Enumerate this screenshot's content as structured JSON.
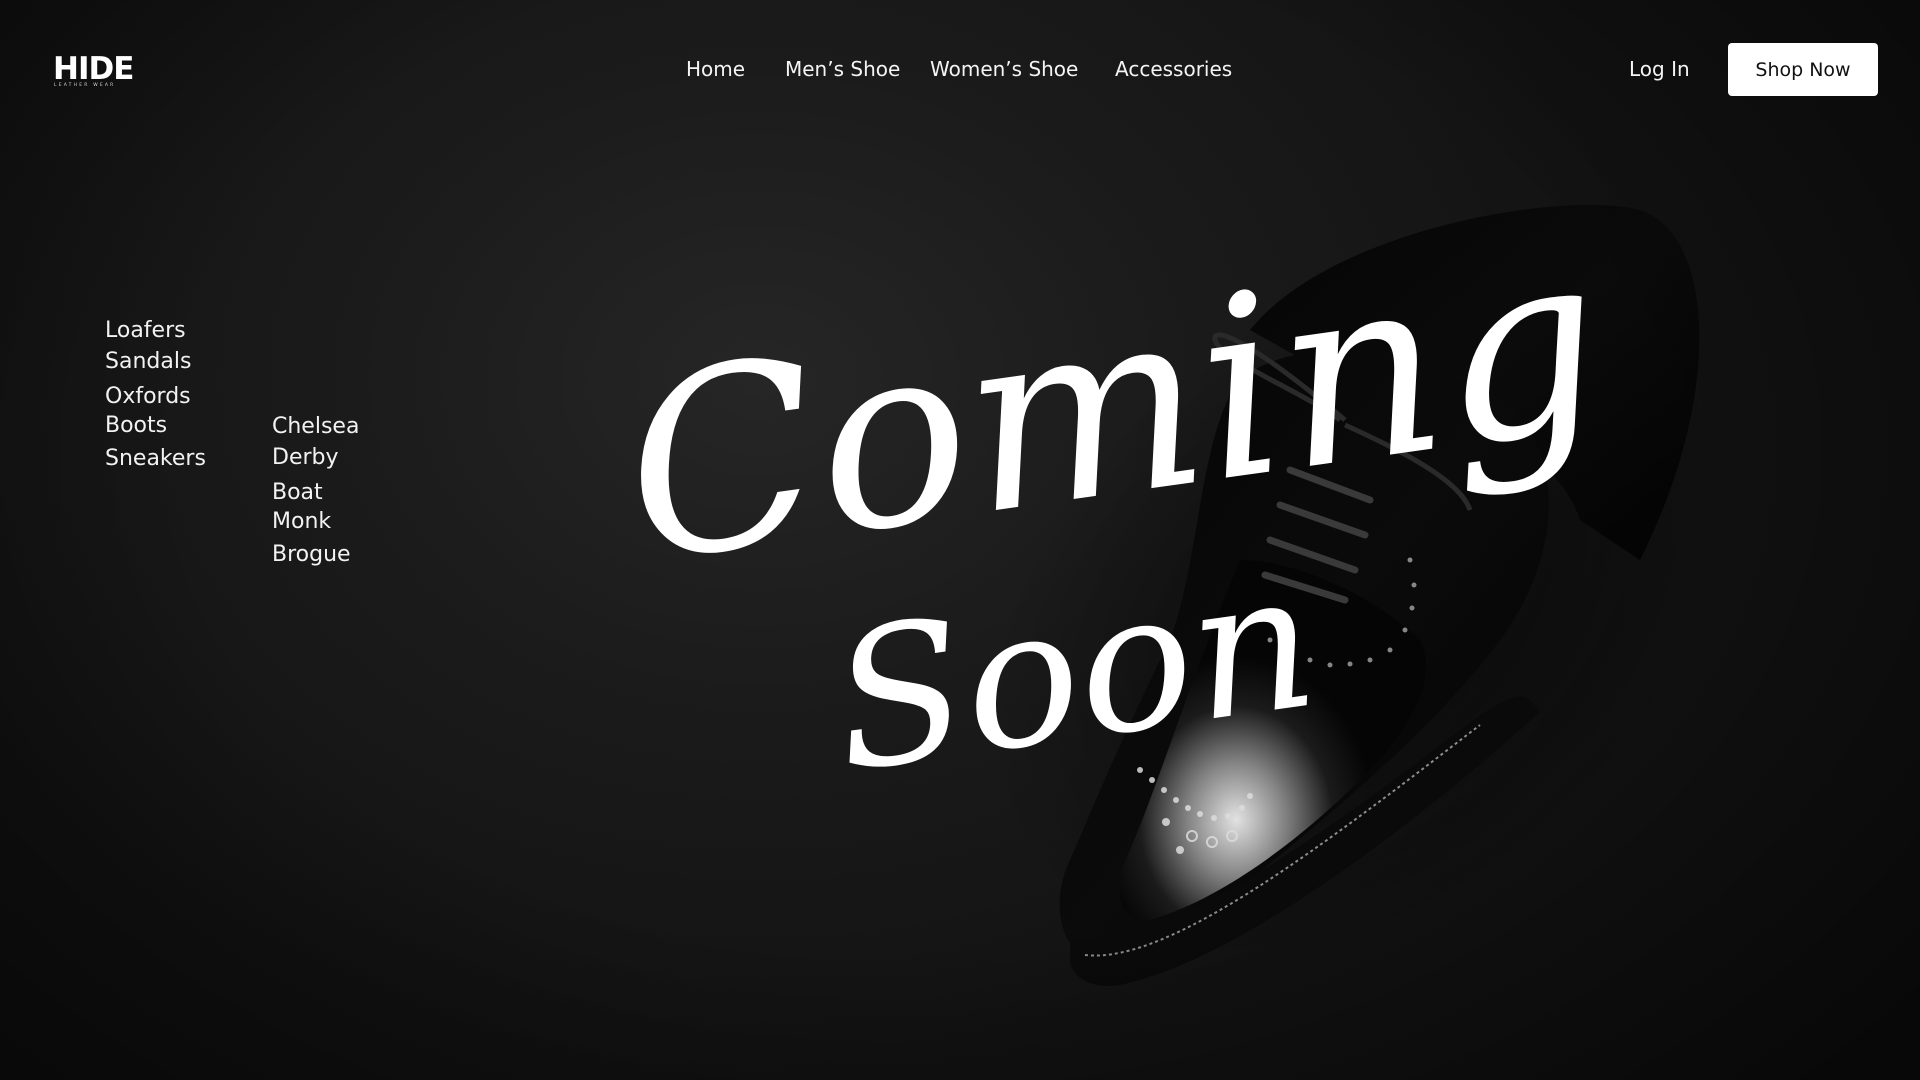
{
  "brand": {
    "name": "HIDE",
    "tagline": "LEATHER WEAR"
  },
  "nav": {
    "items": [
      "Home",
      "Men’s Shoe",
      "Women’s Shoe",
      "Accessories"
    ],
    "login_label": "Log In",
    "cta_label": "Shop Now"
  },
  "categories": {
    "primary": [
      "Loafers",
      "Sandals",
      "Oxfords",
      "Boots",
      "Sneakers"
    ],
    "secondary": [
      "Chelsea",
      "Derby",
      "Boat",
      "Monk",
      "Brogue"
    ]
  },
  "hero": {
    "headline_line1": "Coming",
    "headline_line2": "Soon",
    "image": "black-leather-brogue-shoe"
  },
  "colors": {
    "background": "#141414",
    "text": "#ffffff",
    "button_bg": "#ffffff",
    "button_text": "#111111"
  }
}
